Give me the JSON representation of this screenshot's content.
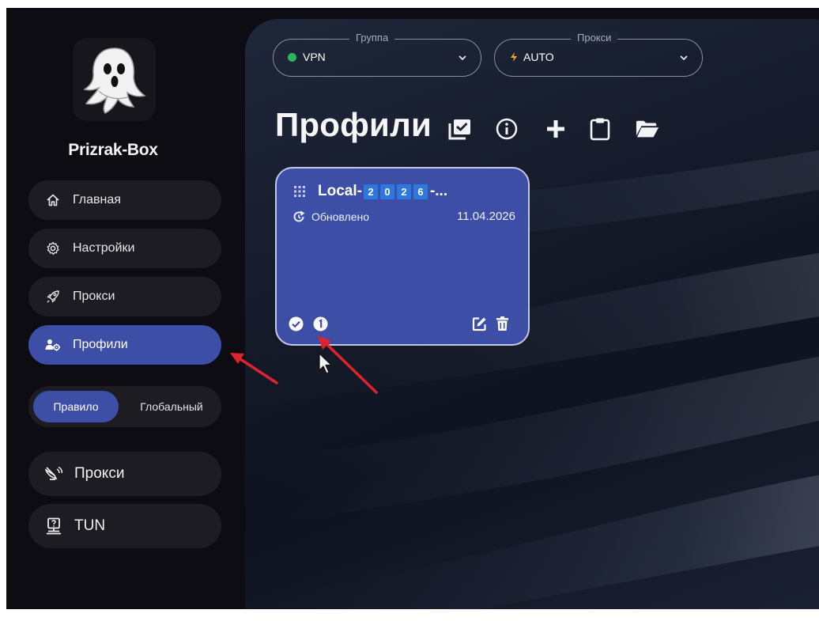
{
  "app": {
    "name": "Prizrak-Box",
    "logo_icon": "ghost-icon"
  },
  "sidebar": {
    "items": [
      {
        "label": "Главная",
        "icon": "home-icon",
        "active": false
      },
      {
        "label": "Настройки",
        "icon": "gear-icon",
        "active": false
      },
      {
        "label": "Прокси",
        "icon": "rocket-icon",
        "active": false
      },
      {
        "label": "Профили",
        "icon": "profiles-icon",
        "active": true
      }
    ],
    "mode": {
      "options": [
        "Правило",
        "Глобальный"
      ],
      "selected": "Правило"
    },
    "toggles": [
      {
        "label": "Прокси",
        "icon": "proxy-antenna-icon"
      },
      {
        "label": "TUN",
        "icon": "tun-monitor-icon"
      }
    ]
  },
  "header": {
    "group_select": {
      "legend": "Группа",
      "value": "VPN",
      "status_color": "#2fb45a"
    },
    "proxy_select": {
      "legend": "Прокси",
      "value": "AUTO",
      "icon": "bolt-icon",
      "icon_color": "#f0a43a"
    }
  },
  "main": {
    "title": "Профили",
    "toolbar_icons": [
      "checkbox-list-icon",
      "info-icon",
      "plus-icon",
      "clipboard-icon",
      "folder-open-icon"
    ]
  },
  "profile_card": {
    "name_prefix": "Local-",
    "name_digits": [
      "2",
      "0",
      "2",
      "6"
    ],
    "name_suffix": "-...",
    "updated_label": "Обновлено",
    "updated_date": "11.04.2026",
    "footer_icons": [
      "check-circle-icon",
      "info-badge-icon",
      "edit-icon",
      "trash-icon"
    ]
  },
  "colors": {
    "accent": "#3d4ea6",
    "sidebar_bg": "#0c0c12",
    "nav_bg": "#1c1c22",
    "annotation_arrow": "#e0232b"
  }
}
